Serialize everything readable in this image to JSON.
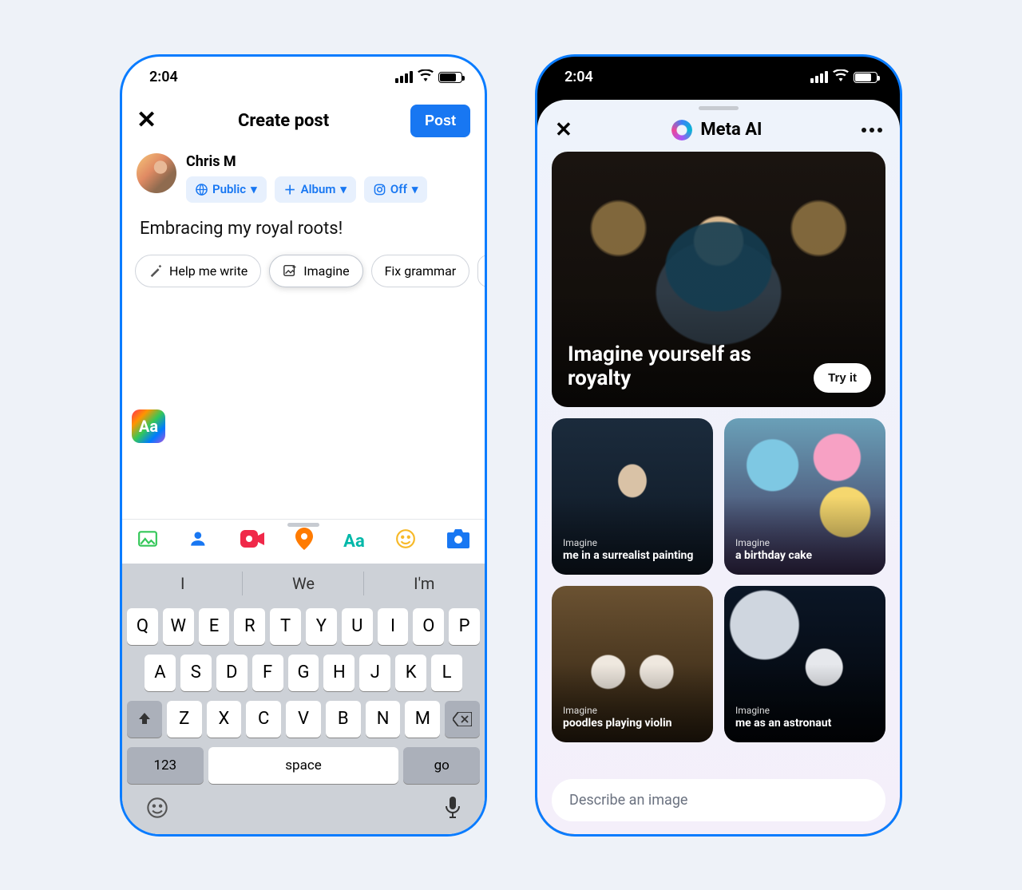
{
  "status": {
    "time": "2:04"
  },
  "left": {
    "header": {
      "title": "Create post",
      "post": "Post"
    },
    "author": {
      "name": "Chris M",
      "chips": {
        "audience": "Public",
        "album": "Album",
        "ig": "Off"
      }
    },
    "composer_text": "Embracing my royal roots!",
    "suggestions": {
      "write": "Help me write",
      "imagine": "Imagine",
      "grammar": "Fix grammar"
    },
    "aa_badge": "Aa",
    "typeahead": {
      "a": "I",
      "b": "We",
      "c": "I'm"
    },
    "keys": {
      "row1": [
        "Q",
        "W",
        "E",
        "R",
        "T",
        "Y",
        "U",
        "I",
        "O",
        "P"
      ],
      "row2": [
        "A",
        "S",
        "D",
        "F",
        "G",
        "H",
        "J",
        "K",
        "L"
      ],
      "row3": [
        "Z",
        "X",
        "C",
        "V",
        "B",
        "N",
        "M"
      ],
      "num": "123",
      "space": "space",
      "go": "go"
    }
  },
  "right": {
    "title": "Meta AI",
    "hero": {
      "headline": "Imagine yourself as royalty",
      "cta": "Try it"
    },
    "tiles": {
      "t1": {
        "pre": "Imagine",
        "label": "me in a surrealist painting"
      },
      "t2": {
        "pre": "Imagine",
        "label": "a birthday cake"
      },
      "t3": {
        "pre": "Imagine",
        "label": "poodles playing violin"
      },
      "t4": {
        "pre": "Imagine",
        "label": "me as an astronaut"
      }
    },
    "prompt_placeholder": "Describe an image"
  }
}
